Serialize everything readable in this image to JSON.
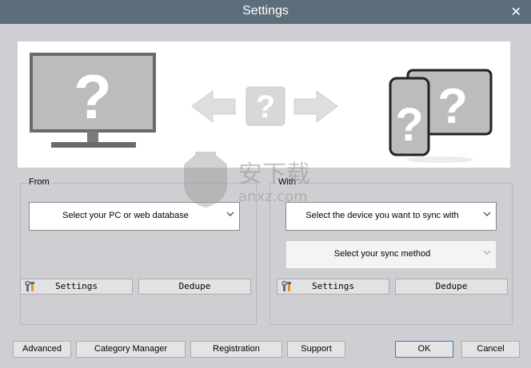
{
  "window": {
    "title": "Settings",
    "close_glyph": "✕"
  },
  "banner": {
    "left_icon": "monitor-icon",
    "center_icon": "question-icon",
    "right_icon": "mobile-devices-icon",
    "placeholder_glyph": "?"
  },
  "from_group": {
    "legend": "From",
    "source_select": "Select your PC or web database",
    "settings_label": "Settings",
    "dedupe_label": "Dedupe"
  },
  "with_group": {
    "legend": "With",
    "device_select": "Select the device you want to sync with",
    "method_select": "Select your sync method",
    "settings_label": "Settings",
    "dedupe_label": "Dedupe"
  },
  "footer": {
    "advanced": "Advanced",
    "category_manager": "Category Manager",
    "registration": "Registration",
    "support": "Support",
    "ok": "OK",
    "cancel": "Cancel"
  },
  "watermark": {
    "text": "安下载",
    "subtext": "anxz.com"
  },
  "colors": {
    "titlebar": "#5c6d7b",
    "background": "#cfcfd3",
    "ok_border": "#3a78c4"
  }
}
